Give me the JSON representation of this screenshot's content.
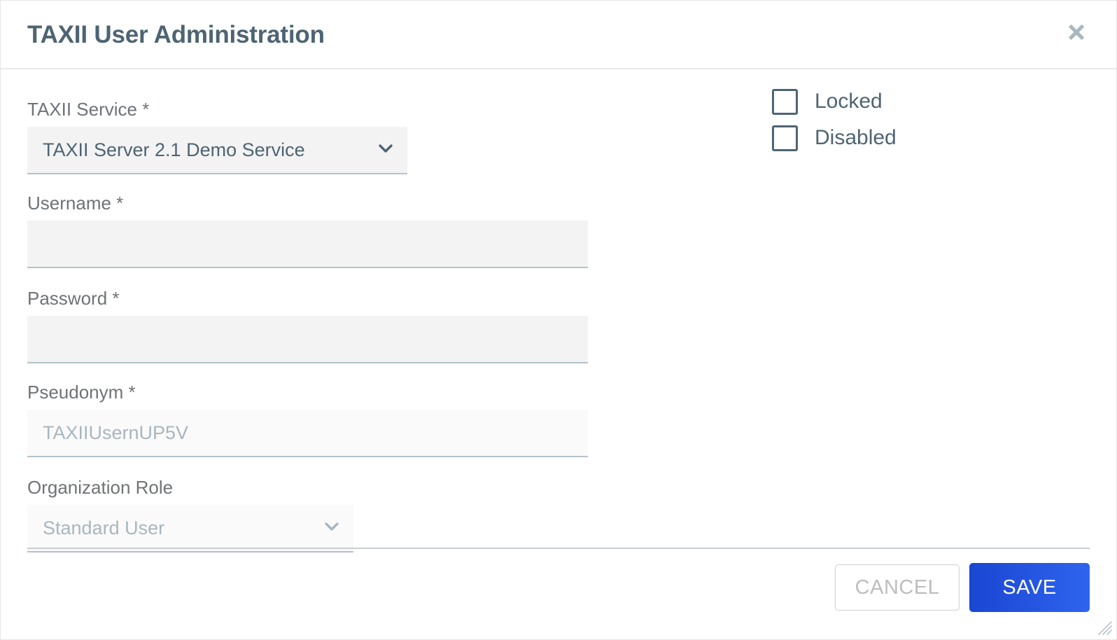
{
  "dialog": {
    "title": "TAXII User Administration",
    "close_icon": "close-icon"
  },
  "form": {
    "taxii_service": {
      "label": "TAXII Service *",
      "value": "TAXII Server 2.1 Demo Service",
      "chevron_icon": "chevron-down-icon"
    },
    "username": {
      "label": "Username *",
      "value": "",
      "placeholder": ""
    },
    "password": {
      "label": "Password *",
      "value": "",
      "placeholder": ""
    },
    "pseudonym": {
      "label": "Pseudonym *",
      "value": "",
      "placeholder": "TAXIIUsernUP5V"
    },
    "organization_role": {
      "label": "Organization Role",
      "value": "Standard User",
      "chevron_icon": "chevron-down-icon"
    }
  },
  "checkboxes": [
    {
      "label": "Locked",
      "checked": false
    },
    {
      "label": "Disabled",
      "checked": false
    }
  ],
  "footer": {
    "cancel_label": "CANCEL",
    "save_label": "SAVE"
  },
  "colors": {
    "title": "#4e6472",
    "label": "#6f7377",
    "field_bg": "#f3f3f4",
    "field_bg_muted": "#fafafa",
    "field_underline": "#b4c2cc",
    "accent_save_from": "#1a46d2",
    "accent_save_to": "#2f64ee",
    "cancel_text": "#bdbdbd",
    "checkbox_border": "#4e6472",
    "placeholder": "#a9b6bf"
  }
}
